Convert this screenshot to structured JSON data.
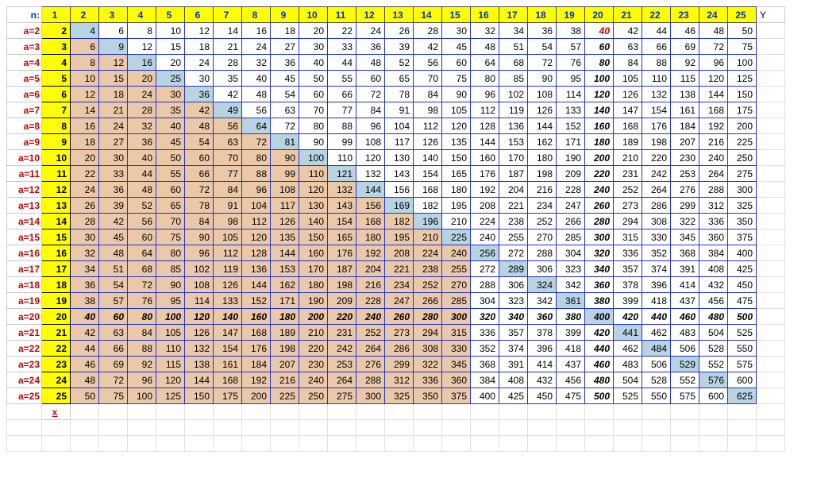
{
  "labels": {
    "n": "n:",
    "Y": "Y",
    "x": "x",
    "row_prefix": "a="
  },
  "n_values": [
    1,
    2,
    3,
    4,
    5,
    6,
    7,
    8,
    9,
    10,
    11,
    12,
    13,
    14,
    15,
    16,
    17,
    18,
    19,
    20,
    21,
    22,
    23,
    24,
    25
  ],
  "a_values": [
    2,
    3,
    4,
    5,
    6,
    7,
    8,
    9,
    10,
    11,
    12,
    13,
    14,
    15,
    16,
    17,
    18,
    19,
    20,
    21,
    22,
    23,
    24,
    25
  ],
  "grid": [
    [
      2,
      4,
      6,
      8,
      10,
      12,
      14,
      16,
      18,
      20,
      22,
      24,
      26,
      28,
      30,
      32,
      34,
      36,
      38,
      40,
      42,
      44,
      46,
      48,
      50
    ],
    [
      3,
      6,
      9,
      12,
      15,
      18,
      21,
      24,
      27,
      30,
      33,
      36,
      39,
      42,
      45,
      48,
      51,
      54,
      57,
      60,
      63,
      66,
      69,
      72,
      75
    ],
    [
      4,
      8,
      12,
      16,
      20,
      24,
      28,
      32,
      36,
      40,
      44,
      48,
      52,
      56,
      60,
      64,
      68,
      72,
      76,
      80,
      84,
      88,
      92,
      96,
      100
    ],
    [
      5,
      10,
      15,
      20,
      25,
      30,
      35,
      40,
      45,
      50,
      55,
      60,
      65,
      70,
      75,
      80,
      85,
      90,
      95,
      100,
      105,
      110,
      115,
      120,
      125
    ],
    [
      6,
      12,
      18,
      24,
      30,
      36,
      42,
      48,
      54,
      60,
      66,
      72,
      78,
      84,
      90,
      96,
      102,
      108,
      114,
      120,
      126,
      132,
      138,
      144,
      150
    ],
    [
      7,
      14,
      21,
      28,
      35,
      42,
      49,
      56,
      63,
      70,
      77,
      84,
      91,
      98,
      105,
      112,
      119,
      126,
      133,
      140,
      147,
      154,
      161,
      168,
      175
    ],
    [
      8,
      16,
      24,
      32,
      40,
      48,
      56,
      64,
      72,
      80,
      88,
      96,
      104,
      112,
      120,
      128,
      136,
      144,
      152,
      160,
      168,
      176,
      184,
      192,
      200
    ],
    [
      9,
      18,
      27,
      36,
      45,
      54,
      63,
      72,
      81,
      90,
      99,
      108,
      117,
      126,
      135,
      144,
      153,
      162,
      171,
      180,
      189,
      198,
      207,
      216,
      225
    ],
    [
      10,
      20,
      30,
      40,
      50,
      60,
      70,
      80,
      90,
      100,
      110,
      120,
      130,
      140,
      150,
      160,
      170,
      180,
      190,
      200,
      210,
      220,
      230,
      240,
      250
    ],
    [
      11,
      22,
      33,
      44,
      55,
      66,
      77,
      88,
      99,
      110,
      121,
      132,
      143,
      154,
      165,
      176,
      187,
      198,
      209,
      220,
      231,
      242,
      253,
      264,
      275
    ],
    [
      12,
      24,
      36,
      48,
      60,
      72,
      84,
      96,
      108,
      120,
      132,
      144,
      156,
      168,
      180,
      192,
      204,
      216,
      228,
      240,
      252,
      264,
      276,
      288,
      300
    ],
    [
      13,
      26,
      39,
      52,
      65,
      78,
      91,
      104,
      117,
      130,
      143,
      156,
      169,
      182,
      195,
      208,
      221,
      234,
      247,
      260,
      273,
      286,
      299,
      312,
      325
    ],
    [
      14,
      28,
      42,
      56,
      70,
      84,
      98,
      112,
      126,
      140,
      154,
      168,
      182,
      196,
      210,
      224,
      238,
      252,
      266,
      280,
      294,
      308,
      322,
      336,
      350
    ],
    [
      15,
      30,
      45,
      60,
      75,
      90,
      105,
      120,
      135,
      150,
      165,
      180,
      195,
      210,
      225,
      240,
      255,
      270,
      285,
      300,
      315,
      330,
      345,
      360,
      375
    ],
    [
      16,
      32,
      48,
      64,
      80,
      96,
      112,
      128,
      144,
      160,
      176,
      192,
      208,
      224,
      240,
      256,
      272,
      288,
      304,
      320,
      336,
      352,
      368,
      384,
      400
    ],
    [
      17,
      34,
      51,
      68,
      85,
      102,
      119,
      136,
      153,
      170,
      187,
      204,
      221,
      238,
      255,
      272,
      289,
      306,
      323,
      340,
      357,
      374,
      391,
      408,
      425
    ],
    [
      18,
      36,
      54,
      72,
      90,
      108,
      126,
      144,
      162,
      180,
      198,
      216,
      234,
      252,
      270,
      288,
      306,
      324,
      342,
      360,
      378,
      396,
      414,
      432,
      450
    ],
    [
      19,
      38,
      57,
      76,
      95,
      114,
      133,
      152,
      171,
      190,
      209,
      228,
      247,
      266,
      285,
      304,
      323,
      342,
      361,
      380,
      399,
      418,
      437,
      456,
      475
    ],
    [
      20,
      40,
      60,
      80,
      100,
      120,
      140,
      160,
      180,
      200,
      220,
      240,
      260,
      280,
      300,
      320,
      340,
      360,
      380,
      400,
      420,
      440,
      460,
      480,
      500
    ],
    [
      21,
      42,
      63,
      84,
      105,
      126,
      147,
      168,
      189,
      210,
      231,
      252,
      273,
      294,
      315,
      336,
      357,
      378,
      399,
      420,
      441,
      462,
      483,
      504,
      525
    ],
    [
      22,
      44,
      66,
      88,
      110,
      132,
      154,
      176,
      198,
      220,
      242,
      264,
      286,
      308,
      330,
      352,
      374,
      396,
      418,
      440,
      462,
      484,
      506,
      528,
      550
    ],
    [
      23,
      46,
      69,
      92,
      115,
      138,
      161,
      184,
      207,
      230,
      253,
      276,
      299,
      322,
      345,
      368,
      391,
      414,
      437,
      460,
      483,
      506,
      529,
      552,
      575
    ],
    [
      24,
      48,
      72,
      96,
      120,
      144,
      168,
      192,
      216,
      240,
      264,
      288,
      312,
      336,
      360,
      384,
      408,
      432,
      456,
      480,
      504,
      528,
      552,
      576,
      600
    ],
    [
      25,
      50,
      75,
      100,
      125,
      150,
      175,
      200,
      225,
      250,
      275,
      300,
      325,
      350,
      375,
      400,
      425,
      450,
      475,
      500,
      525,
      550,
      575,
      600,
      625
    ]
  ],
  "bold_row_a": 20,
  "bold_col_n": 20
}
